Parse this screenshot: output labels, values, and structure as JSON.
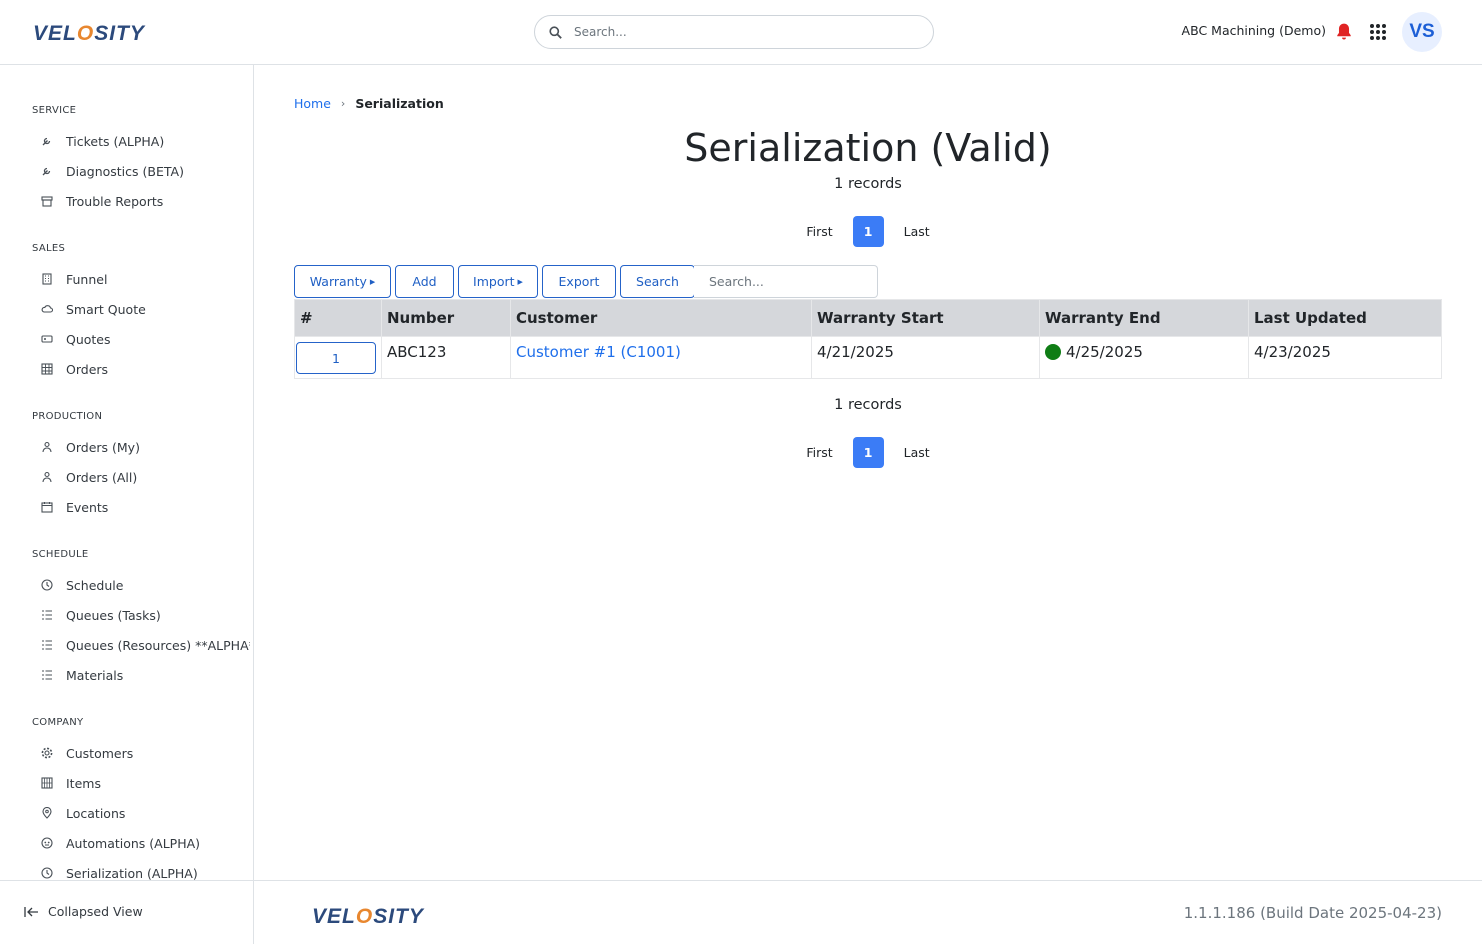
{
  "header": {
    "logo_text": "VELOSITY",
    "search_placeholder": "Search...",
    "company": "ABC Machining (Demo)",
    "avatar_initials": "VS",
    "accent_color": "#3b7cf6",
    "alert_color": "#e02424"
  },
  "sidebar": {
    "sections": [
      {
        "title": "SERVICE",
        "items": [
          {
            "label": "Tickets (ALPHA)",
            "icon": "wrench-icon"
          },
          {
            "label": "Diagnostics (BETA)",
            "icon": "wrench-icon"
          },
          {
            "label": "Trouble Reports",
            "icon": "archive-icon"
          }
        ]
      },
      {
        "title": "SALES",
        "items": [
          {
            "label": "Funnel",
            "icon": "building-icon"
          },
          {
            "label": "Smart Quote",
            "icon": "cloud-icon"
          },
          {
            "label": "Quotes",
            "icon": "tag-icon"
          },
          {
            "label": "Orders",
            "icon": "table-icon"
          }
        ]
      },
      {
        "title": "PRODUCTION",
        "items": [
          {
            "label": "Orders (My)",
            "icon": "person-gear-icon"
          },
          {
            "label": "Orders (All)",
            "icon": "person-gear-icon"
          },
          {
            "label": "Events",
            "icon": "calendar-icon"
          }
        ]
      },
      {
        "title": "SCHEDULE",
        "items": [
          {
            "label": "Schedule",
            "icon": "clock-icon"
          },
          {
            "label": "Queues (Tasks)",
            "icon": "list-icon"
          },
          {
            "label": "Queues (Resources) **ALPHA**",
            "icon": "list-icon"
          },
          {
            "label": "Materials",
            "icon": "list-icon"
          }
        ]
      },
      {
        "title": "COMPANY",
        "items": [
          {
            "label": "Customers",
            "icon": "gear-icon"
          },
          {
            "label": "Items",
            "icon": "grid-icon"
          },
          {
            "label": "Locations",
            "icon": "pin-icon"
          },
          {
            "label": "Automations (ALPHA)",
            "icon": "robot-icon"
          },
          {
            "label": "Serialization (ALPHA)",
            "icon": "clock-icon"
          }
        ]
      }
    ],
    "collapse_label": "Collapsed View"
  },
  "breadcrumb": {
    "home": "Home",
    "current": "Serialization"
  },
  "main": {
    "title": "Serialization (Valid)",
    "records_text": "1 records",
    "pager": {
      "first": "First",
      "page": "1",
      "last": "Last"
    },
    "toolbar": {
      "warranty": "Warranty",
      "add": "Add",
      "import": "Import",
      "export": "Export",
      "search": "Search",
      "search_placeholder": "Search..."
    },
    "table": {
      "columns": [
        "#",
        "Number",
        "Customer",
        "Warranty Start",
        "Warranty End",
        "Last Updated"
      ],
      "rows": [
        {
          "index": "1",
          "number": "ABC123",
          "customer": "Customer #1 (C1001)",
          "warranty_start": "4/21/2025",
          "warranty_end": "4/25/2025",
          "warranty_status_color": "#0f7d15",
          "last_updated": "4/23/2025"
        }
      ]
    }
  },
  "footer": {
    "version": "1.1.1.186 (Build Date 2025-04-23)"
  }
}
